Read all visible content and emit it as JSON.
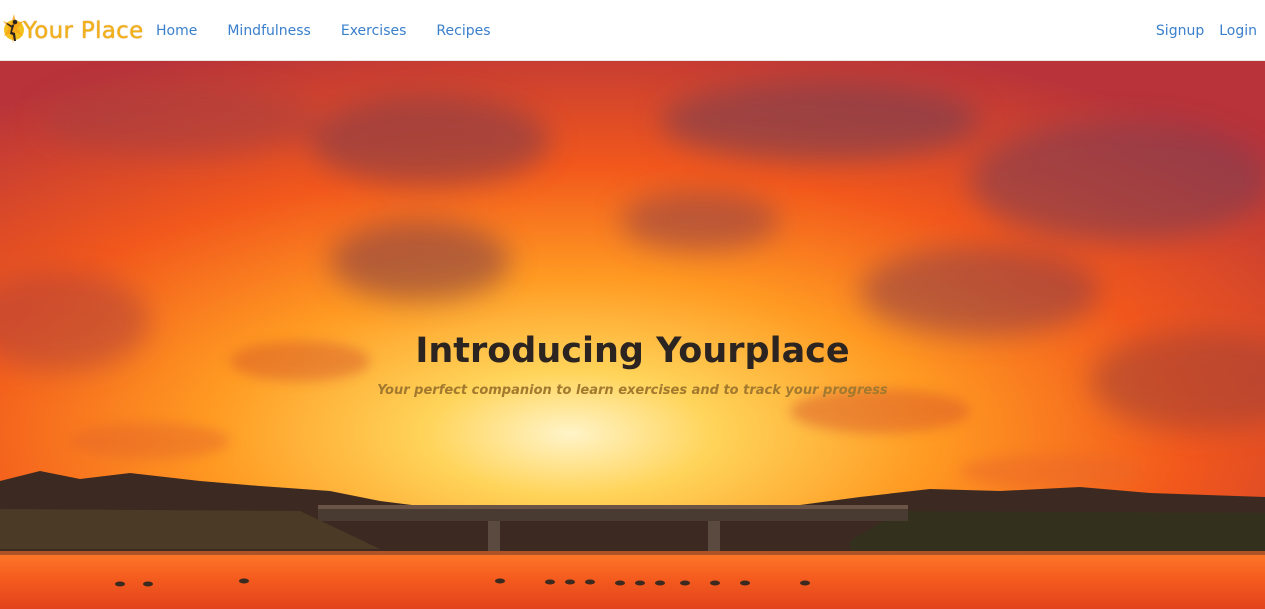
{
  "brand": {
    "name": "Your Place",
    "icon": "yoga-figure-icon",
    "color": "#f2b019"
  },
  "nav": {
    "left": [
      "Home",
      "Mindfulness",
      "Exercises",
      "Recipes"
    ],
    "right": [
      "Signup",
      "Login"
    ],
    "link_color": "#3a7fcb"
  },
  "hero": {
    "title": "Introducing Yourplace",
    "subtitle": "Your perfect companion to learn exercises and to track your progress",
    "background": "sunset-over-lake-with-bridge"
  }
}
